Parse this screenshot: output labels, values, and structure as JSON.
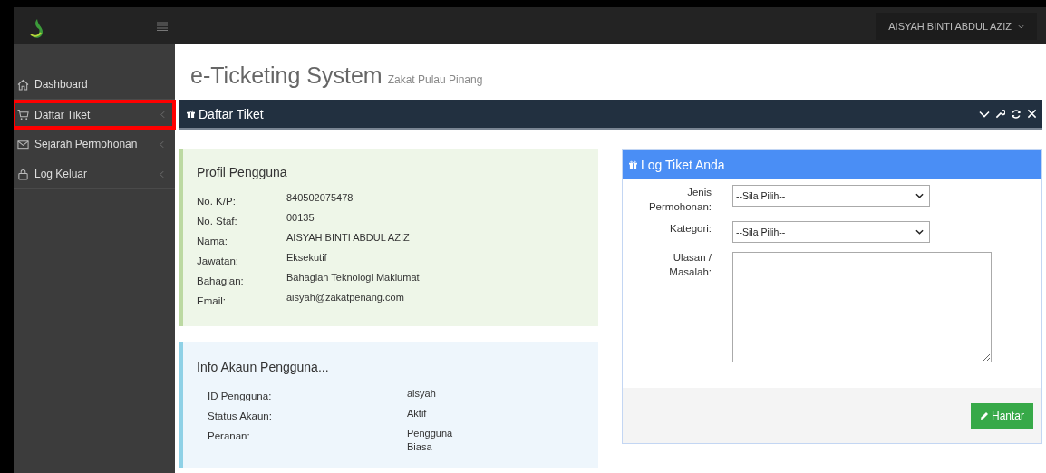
{
  "topbar": {
    "user": "AISYAH BINTI ABDUL AZIZ"
  },
  "sidebar": {
    "items": [
      {
        "label": "Dashboard",
        "highlighted": false,
        "expandable": false
      },
      {
        "label": "Daftar Tiket",
        "highlighted": true,
        "expandable": true
      },
      {
        "label": "Sejarah Permohonan",
        "highlighted": false,
        "expandable": true
      },
      {
        "label": "Log Keluar",
        "highlighted": false,
        "expandable": true
      }
    ]
  },
  "page": {
    "title": "e-Ticketing System",
    "subtitle": "Zakat Pulau Pinang"
  },
  "panel": {
    "title": "Daftar Tiket"
  },
  "profile": {
    "title": "Profil Pengguna",
    "rows": [
      {
        "label": "No. K/P:",
        "value": "840502075478"
      },
      {
        "label": "No. Staf:",
        "value": "00135"
      },
      {
        "label": "Nama:",
        "value": "AISYAH BINTI ABDUL AZIZ"
      },
      {
        "label": "Jawatan:",
        "value": "Eksekutif"
      },
      {
        "label": "Bahagian:",
        "value": "Bahagian Teknologi Maklumat"
      },
      {
        "label": "Email:",
        "value": "aisyah@zakatpenang.com"
      }
    ]
  },
  "account": {
    "title": "Info Akaun Pengguna...",
    "rows": [
      {
        "label": "ID Pengguna:",
        "value": "aisyah"
      },
      {
        "label": "Status Akaun:",
        "value": "Aktif"
      },
      {
        "label": "Peranan:",
        "value": "Pengguna Biasa"
      }
    ]
  },
  "form": {
    "title": "Log Tiket Anda",
    "fields": [
      {
        "kind": "select",
        "label": "Jenis Permohonan:",
        "value": "--Sila Pilih--"
      },
      {
        "kind": "select",
        "label": "Kategori:",
        "value": "--Sila Pilih--"
      },
      {
        "kind": "textarea",
        "label": "Ulasan / Masalah:"
      }
    ],
    "submit": "Hantar"
  }
}
